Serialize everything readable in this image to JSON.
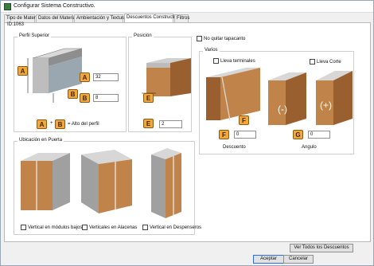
{
  "window": {
    "title": "Configurar Sistema Constructivo."
  },
  "tabs": [
    {
      "label": "Tipo de Material"
    },
    {
      "label": "Datos del Material"
    },
    {
      "label": "Ambientación y Texturas"
    },
    {
      "label": "Descuentos Constructivos"
    },
    {
      "label": "Filtros"
    }
  ],
  "id_label": "ID:1063",
  "perfil": {
    "title": "Perfil Superior",
    "a_value": "32",
    "b_value": "8",
    "formula_text": "= Alto del perfil",
    "badge_a": "A",
    "badge_b": "B",
    "plus": "+"
  },
  "posicion": {
    "title": "Posición",
    "e_value": "2",
    "badge_e": "E"
  },
  "no_quitar": {
    "label": "No quitar tapacanto"
  },
  "varios": {
    "title": "Varios",
    "lleva_terminales": "Lleva terminales",
    "lleva_corte": "Lleva Corte",
    "badge_f": "F",
    "badge_g": "G",
    "f_value": "0",
    "g_value": "0",
    "descuento_label": "Descuento",
    "angulo_label": "Angulo",
    "minus_symbol": "(-)",
    "plus_symbol": "(+)"
  },
  "ubicacion": {
    "title": "Ubicación en Puerta",
    "opt1": "Vertical en módulos bajos",
    "opt2": "Verticales en Alacenas",
    "opt3": "Vertical en Despenseros"
  },
  "buttons": {
    "ver_todos": "Ver Todos los Descuentos",
    "aceptar": "Aceptar",
    "cancelar": "Cancelar"
  },
  "colors": {
    "badge": "#f3a63a",
    "wood": "#c0834a",
    "wood_dark": "#9a5f2e",
    "metal": "#a7a7a7"
  }
}
